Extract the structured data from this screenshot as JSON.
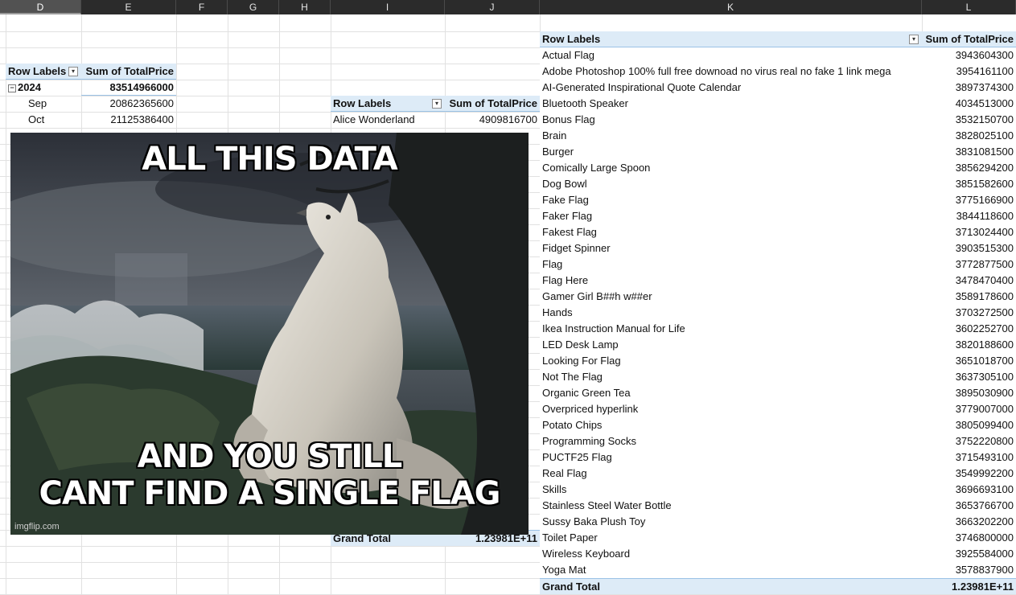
{
  "columns": [
    {
      "label": "D",
      "selected": true
    },
    {
      "label": "E",
      "selected": false
    },
    {
      "label": "F",
      "selected": false
    },
    {
      "label": "G",
      "selected": false
    },
    {
      "label": "H",
      "selected": false
    },
    {
      "label": "I",
      "selected": false
    },
    {
      "label": "J",
      "selected": false
    },
    {
      "label": "K",
      "selected": false
    },
    {
      "label": "L",
      "selected": false
    }
  ],
  "pivot_date": {
    "header_label": "Row Labels",
    "header_value": "Sum of TotalPrice",
    "year_label": "2024",
    "year_value": "83514966000",
    "rows": [
      {
        "label": "Sep",
        "value": "20862365600"
      },
      {
        "label": "Oct",
        "value": "21125386400"
      }
    ]
  },
  "pivot_customer": {
    "header_label": "Row Labels",
    "header_value": "Sum of TotalPrice",
    "first_label": "Alice Wonderland",
    "first_value": "4909816700",
    "total_label": "Grand Total",
    "total_value": "1.23981E+11"
  },
  "pivot_product": {
    "header_label": "Row Labels",
    "header_value": "Sum of TotalPrice",
    "rows": [
      {
        "label": "Actual Flag",
        "value": "3943604300"
      },
      {
        "label": "Adobe Photoshop 100% full free downoad no virus real no fake 1 link mega",
        "value": "3954161100"
      },
      {
        "label": "AI-Generated Inspirational Quote Calendar",
        "value": "3897374300"
      },
      {
        "label": "Bluetooth Speaker",
        "value": "4034513000"
      },
      {
        "label": "Bonus Flag",
        "value": "3532150700"
      },
      {
        "label": "Brain",
        "value": "3828025100"
      },
      {
        "label": "Burger",
        "value": "3831081500"
      },
      {
        "label": "Comically Large Spoon",
        "value": "3856294200"
      },
      {
        "label": "Dog Bowl",
        "value": "3851582600"
      },
      {
        "label": "Fake Flag",
        "value": "3775166900"
      },
      {
        "label": "Faker Flag",
        "value": "3844118600"
      },
      {
        "label": "Fakest Flag",
        "value": "3713024400"
      },
      {
        "label": "Fidget Spinner",
        "value": "3903515300"
      },
      {
        "label": "Flag",
        "value": "3772877500"
      },
      {
        "label": "Flag Here",
        "value": "3478470400"
      },
      {
        "label": "Gamer Girl B##h w##er",
        "value": "3589178600"
      },
      {
        "label": "Hands",
        "value": "3703272500"
      },
      {
        "label": "Ikea Instruction Manual for Life",
        "value": "3602252700"
      },
      {
        "label": "LED Desk Lamp",
        "value": "3820188600"
      },
      {
        "label": "Looking For Flag",
        "value": "3651018700"
      },
      {
        "label": "Not The Flag",
        "value": "3637305100"
      },
      {
        "label": "Organic Green Tea",
        "value": "3895030900"
      },
      {
        "label": "Overpriced hyperlink",
        "value": "3779007000"
      },
      {
        "label": "Potato Chips",
        "value": "3805099400"
      },
      {
        "label": "Programming Socks",
        "value": "3752220800"
      },
      {
        "label": "PUCTF25 Flag",
        "value": "3715493100"
      },
      {
        "label": "Real Flag",
        "value": "3549992200"
      },
      {
        "label": "Skills",
        "value": "3696693100"
      },
      {
        "label": "Stainless Steel Water Bottle",
        "value": "3653766700"
      },
      {
        "label": "Sussy Baka Plush Toy",
        "value": "3663202200"
      },
      {
        "label": "Toilet Paper",
        "value": "3746800000"
      },
      {
        "label": "Wireless Keyboard",
        "value": "3925584000"
      },
      {
        "label": "Yoga Mat",
        "value": "3578837900"
      }
    ],
    "total_label": "Grand Total",
    "total_value": "1.23981E+11"
  },
  "meme": {
    "top_text": "ALL THIS DATA",
    "bottom_line1": "AND YOU STILL",
    "bottom_line2": "CANT FIND A SINGLE FLAG",
    "watermark": "imgflip.com"
  },
  "colors": {
    "header_band": "#ddebf7",
    "column_strip": "#2b2b2b",
    "grid": "#e1e1e1"
  }
}
